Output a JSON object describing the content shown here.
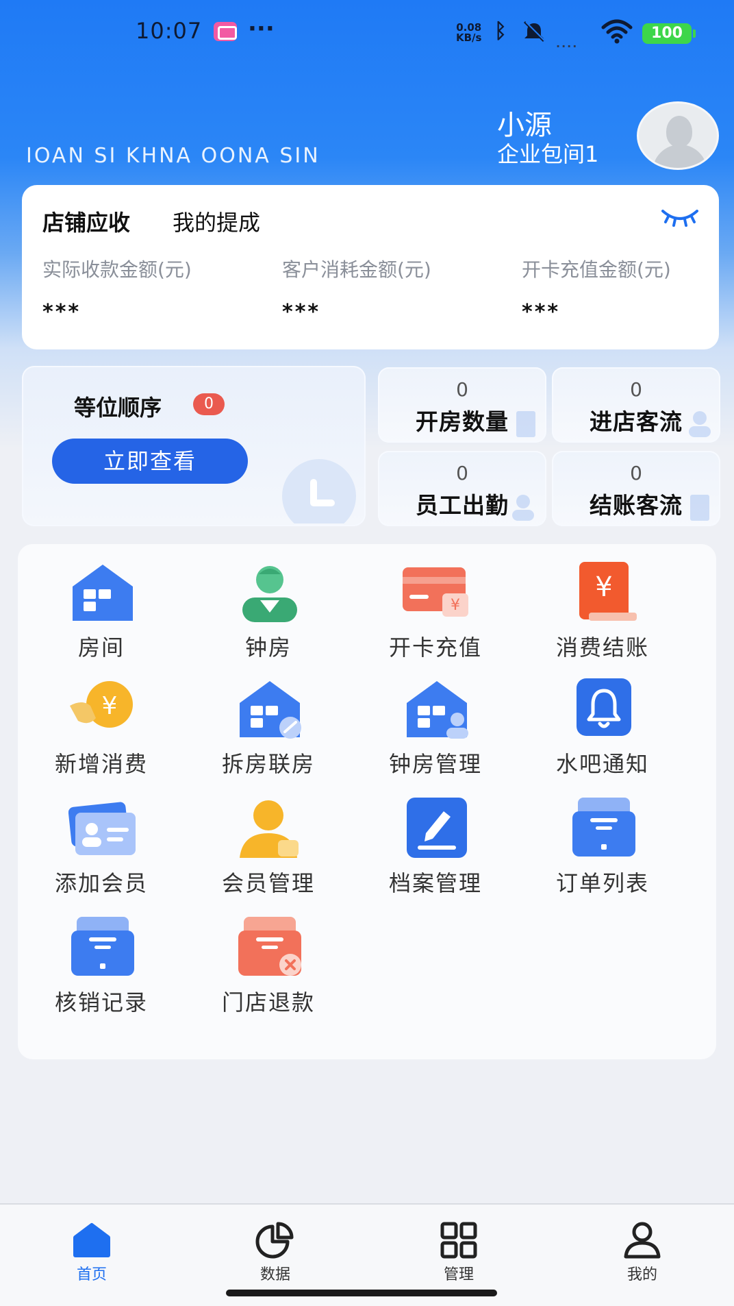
{
  "status_bar": {
    "time": "10:07",
    "dots": "···",
    "net_speed_value": "0.08",
    "net_speed_unit": "KB/s",
    "signal": "....",
    "battery": "100"
  },
  "header": {
    "brand_text": "IOAN SI KHNA OONA SIN",
    "user_name": "小源",
    "user_room": "企业包间1"
  },
  "revenue": {
    "tabs": [
      "店铺应收",
      "我的提成"
    ],
    "columns": [
      {
        "label": "实际收款金额(元)",
        "value": "***"
      },
      {
        "label": "客户消耗金额(元)",
        "value": "***"
      },
      {
        "label": "开卡充值金额(元)",
        "value": "***"
      }
    ]
  },
  "queue": {
    "title": "等位顺序",
    "badge": "0",
    "button": "立即查看"
  },
  "stats": [
    {
      "value": "0",
      "label": "开房数量"
    },
    {
      "value": "0",
      "label": "进店客流"
    },
    {
      "value": "0",
      "label": "员工出勤"
    },
    {
      "value": "0",
      "label": "结账客流"
    }
  ],
  "menu": [
    {
      "label": "房间",
      "icon": "room-icon"
    },
    {
      "label": "钟房",
      "icon": "clock-room-icon"
    },
    {
      "label": "开卡充值",
      "icon": "card-recharge-icon"
    },
    {
      "label": "消费结账",
      "icon": "checkout-icon"
    },
    {
      "label": "新增消费",
      "icon": "add-consumption-icon"
    },
    {
      "label": "拆房联房",
      "icon": "split-merge-room-icon"
    },
    {
      "label": "钟房管理",
      "icon": "clock-room-manage-icon"
    },
    {
      "label": "水吧通知",
      "icon": "bell-icon"
    },
    {
      "label": "添加会员",
      "icon": "add-member-icon"
    },
    {
      "label": "会员管理",
      "icon": "member-manage-icon"
    },
    {
      "label": "档案管理",
      "icon": "archive-edit-icon"
    },
    {
      "label": "订单列表",
      "icon": "order-list-icon"
    },
    {
      "label": "核销记录",
      "icon": "writeoff-record-icon"
    },
    {
      "label": "门店退款",
      "icon": "store-refund-icon"
    }
  ],
  "tabbar": [
    {
      "label": "首页",
      "icon": "home-icon"
    },
    {
      "label": "数据",
      "icon": "pie-chart-icon"
    },
    {
      "label": "管理",
      "icon": "grid-icon"
    },
    {
      "label": "我的",
      "icon": "user-icon"
    }
  ],
  "colors": {
    "primary": "#2564e6",
    "header_blue": "#1f7af5",
    "badge_red": "#ea5a4f",
    "active_tab": "#1e6ff0"
  }
}
